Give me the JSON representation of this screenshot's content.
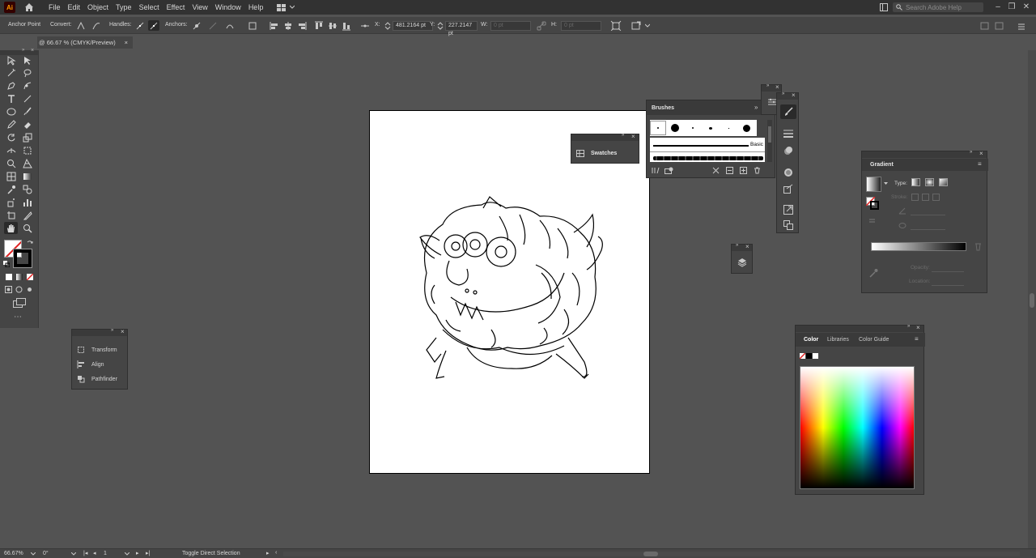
{
  "app": {
    "logo": "Ai"
  },
  "menu": [
    "File",
    "Edit",
    "Object",
    "Type",
    "Select",
    "Effect",
    "View",
    "Window",
    "Help"
  ],
  "search": {
    "placeholder": "Search Adobe Help"
  },
  "control": {
    "selection_label": "Anchor Point",
    "convert_label": "Convert:",
    "handles_label": "Handles:",
    "anchors_label": "Anchors:",
    "x_label": "X:",
    "x_value": "481.2164 pt",
    "y_label": "Y:",
    "y_value": "227.2147 pt",
    "w_label": "W:",
    "w_value": "0 pt",
    "h_label": "H:",
    "h_value": "0 pt"
  },
  "doc": {
    "tab_label": "@ 66.67 % (CMYK/Preview)",
    "close": "×"
  },
  "panels": {
    "dock_items": [
      "Transform",
      "Align",
      "Pathfinder"
    ],
    "swatches": "Swatches",
    "brushes": {
      "title": "Brushes",
      "basic_label": "Basic"
    },
    "gradient": {
      "title": "Gradient",
      "type_label": "Type:",
      "stroke_label": "Stroke:",
      "opacity_label": "Opacity:",
      "location_label": "Location:"
    },
    "color": {
      "tabs": [
        "Color",
        "Libraries",
        "Color Guide"
      ]
    }
  },
  "status": {
    "zoom": "66.67%",
    "rotation": "0°",
    "artboard": "1",
    "tool_hint": "Toggle Direct Selection"
  },
  "colors": {
    "canvas": "#535353",
    "panel": "#454545",
    "menubar": "#323232",
    "accent": "#ff9a00",
    "none_red": "#e02020"
  },
  "icons": [
    "home-icon",
    "search-icon",
    "minimize-icon",
    "maximize-icon",
    "close-icon",
    "selection-tool-icon",
    "direct-selection-tool-icon",
    "pen-tool-icon",
    "type-tool-icon",
    "zoom-tool-icon",
    "hand-tool-icon",
    "layers-icon",
    "brush-icon"
  ]
}
